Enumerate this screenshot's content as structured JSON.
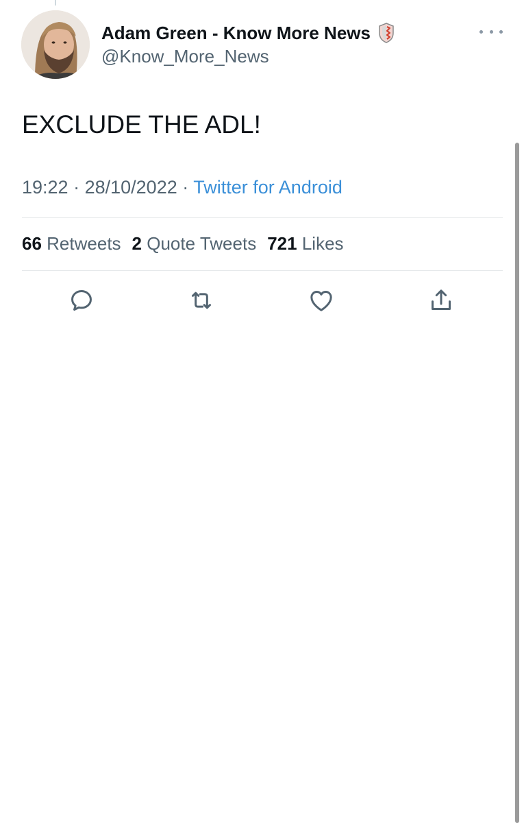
{
  "author": {
    "display_name": "Adam Green - Know More News",
    "handle": "@Know_More_News",
    "badge_icon": "shield-badge-icon",
    "badge_color": "#c0392b"
  },
  "tweet": {
    "text": "EXCLUDE THE ADL!",
    "time": "19:22",
    "date": "28/10/2022",
    "separator": "·",
    "source": "Twitter for Android"
  },
  "stats": {
    "retweets_count": "66",
    "retweets_label": "Retweets",
    "quote_tweets_count": "2",
    "quote_tweets_label": "Quote Tweets",
    "likes_count": "721",
    "likes_label": "Likes"
  },
  "actions": {
    "reply_icon": "reply-icon",
    "retweet_icon": "retweet-icon",
    "like_icon": "like-icon",
    "share_icon": "share-icon"
  },
  "colors": {
    "link": "#3a8fd8",
    "secondary_text": "#536471",
    "icon": "#536471"
  }
}
